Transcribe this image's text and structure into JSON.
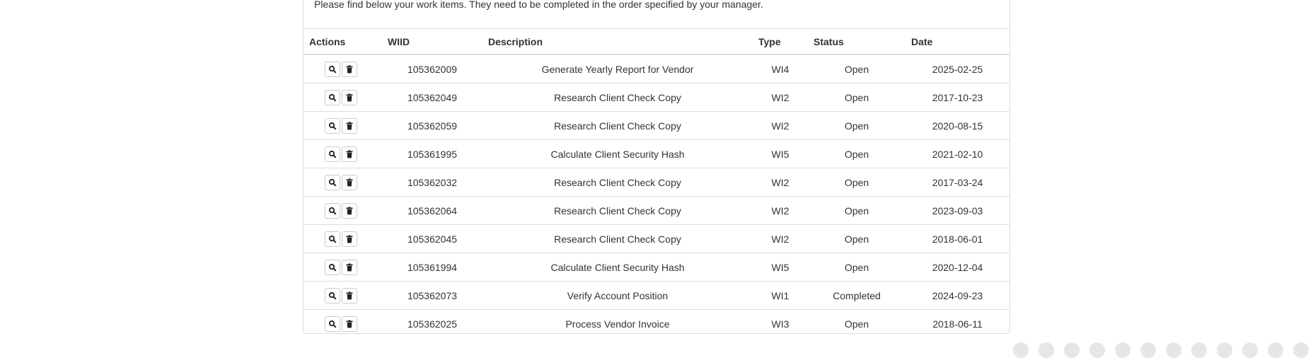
{
  "intro_text": "Please find below your work items. They need to be completed in the order specified by your manager.",
  "table": {
    "headers": {
      "actions": "Actions",
      "wiid": "WIID",
      "description": "Description",
      "type": "Type",
      "status": "Status",
      "date": "Date"
    },
    "rows": [
      {
        "wiid": "105362009",
        "description": "Generate Yearly Report for Vendor",
        "type": "WI4",
        "status": "Open",
        "date": "2025-02-25"
      },
      {
        "wiid": "105362049",
        "description": "Research Client Check Copy",
        "type": "WI2",
        "status": "Open",
        "date": "2017-10-23"
      },
      {
        "wiid": "105362059",
        "description": "Research Client Check Copy",
        "type": "WI2",
        "status": "Open",
        "date": "2020-08-15"
      },
      {
        "wiid": "105361995",
        "description": "Calculate Client Security Hash",
        "type": "WI5",
        "status": "Open",
        "date": "2021-02-10"
      },
      {
        "wiid": "105362032",
        "description": "Research Client Check Copy",
        "type": "WI2",
        "status": "Open",
        "date": "2017-03-24"
      },
      {
        "wiid": "105362064",
        "description": "Research Client Check Copy",
        "type": "WI2",
        "status": "Open",
        "date": "2023-09-03"
      },
      {
        "wiid": "105362045",
        "description": "Research Client Check Copy",
        "type": "WI2",
        "status": "Open",
        "date": "2018-06-01"
      },
      {
        "wiid": "105361994",
        "description": "Calculate Client Security Hash",
        "type": "WI5",
        "status": "Open",
        "date": "2020-12-04"
      },
      {
        "wiid": "105362073",
        "description": "Verify Account Position",
        "type": "WI1",
        "status": "Completed",
        "date": "2024-09-23"
      },
      {
        "wiid": "105362025",
        "description": "Process Vendor Invoice",
        "type": "WI3",
        "status": "Open",
        "date": "2018-06-11"
      }
    ],
    "row_actions": [
      {
        "icon": "search-icon",
        "name": "view-button"
      },
      {
        "icon": "trash-icon",
        "name": "delete-button"
      }
    ]
  },
  "pagination": {
    "count": 12
  },
  "colors": {
    "border": "#dddddd",
    "text": "#333333"
  }
}
